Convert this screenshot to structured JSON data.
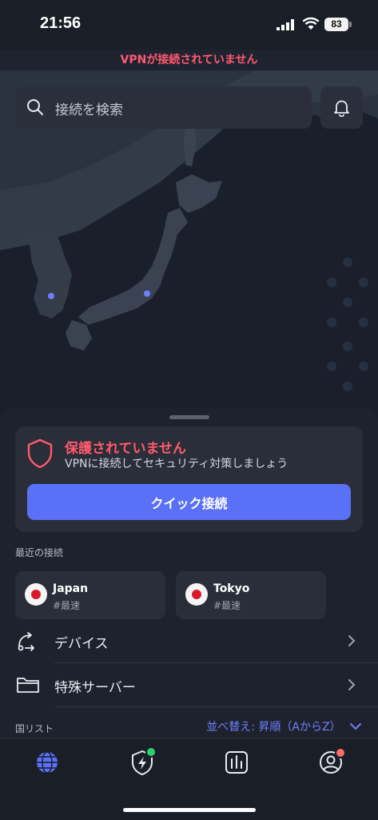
{
  "status_bar": {
    "time": "21:56",
    "battery": "83"
  },
  "vpn_status": "VPNが接続されていません",
  "search": {
    "placeholder": "接続を検索"
  },
  "protection": {
    "title": "保護されていません",
    "subtitle": "VPNに接続してセキュリティ対策しましょう",
    "quick_connect": "クイック接続"
  },
  "recent": {
    "heading": "最近の接続",
    "items": [
      {
        "name": "Japan",
        "sub": "#最速"
      },
      {
        "name": "Tokyo",
        "sub": "#最速"
      }
    ]
  },
  "menu": {
    "devices": "デバイス",
    "special_servers": "特殊サーバー"
  },
  "country_list": {
    "heading": "国リスト",
    "sort": "並べ替え: 昇順（AからZ）"
  },
  "colors": {
    "accent": "#5a70f6",
    "alert": "#ff5a6e",
    "badge_green": "#2fd06b",
    "badge_red": "#ff6b6b"
  },
  "tabs": [
    "globe-icon",
    "shield-bolt-icon",
    "stats-icon",
    "profile-icon"
  ]
}
